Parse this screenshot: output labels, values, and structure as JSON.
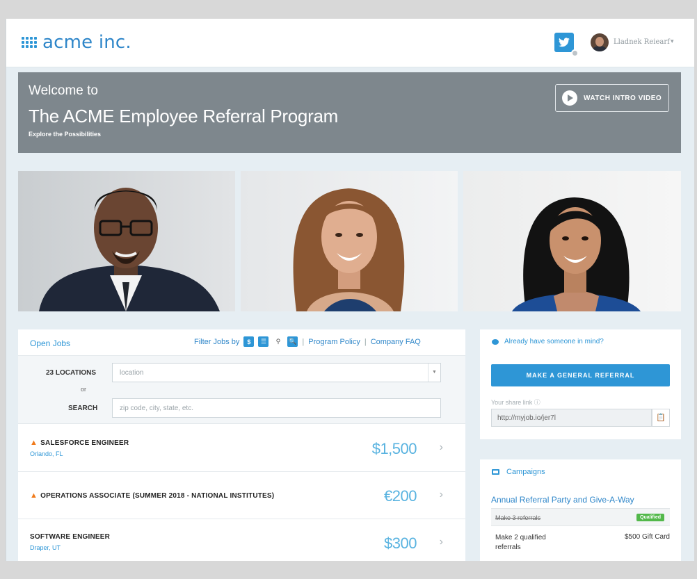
{
  "header": {
    "logo_text": "acme inc.",
    "user_name": "Lladnek Reiearf",
    "user_caret": "▾"
  },
  "hero": {
    "line1": "Welcome to",
    "line2": "The ACME Employee Referral Program",
    "line3": "Explore the Possibilities",
    "video_button": "WATCH INTRO VIDEO"
  },
  "jobs": {
    "title": "Open Jobs",
    "filter_label": "Filter Jobs by",
    "filter_buttons": [
      "$",
      "☰",
      "⚲",
      "🔍"
    ],
    "program_policy": "Program Policy",
    "company_faq": "Company FAQ",
    "separator": "|",
    "locations_label": "23 LOCATIONS",
    "or_label": "or",
    "search_label": "SEARCH",
    "location_placeholder": "location",
    "search_placeholder": "zip code, city, state, etc.",
    "list": [
      {
        "title": "SALESFORCE ENGINEER",
        "location": "Orlando, FL",
        "amount": "$1,500",
        "hot": true
      },
      {
        "title": "OPERATIONS ASSOCIATE (SUMMER 2018 - NATIONAL INSTITUTES)",
        "location": "",
        "amount": "€200",
        "hot": true
      },
      {
        "title": "SOFTWARE ENGINEER",
        "location": "Draper, UT",
        "amount": "$300",
        "hot": false
      }
    ]
  },
  "referral": {
    "prompt": "Already have someone in mind?",
    "general_button": "MAKE A GENERAL REFERRAL",
    "share_label": "Your share link ⓘ",
    "share_link": "http://myjob.io/jer7l",
    "copy_icon": "📋"
  },
  "campaigns": {
    "header": "Campaigns",
    "campaign_title": "Annual Referral Party and Give-A-Way",
    "task1": "Make 3 referrals",
    "task1_status": "Qualified",
    "task2": "Make 2 qualified referrals",
    "task2_reward": "$500 Gift Card"
  },
  "colors": {
    "brand_blue": "#2e96d6",
    "hero_gray": "#7e878d",
    "qualified_green": "#52b84a",
    "hot_orange": "#f07a1b"
  },
  "icons": {
    "logo": "dots-grid-icon",
    "twitter": "twitter-icon",
    "play": "play-icon",
    "flame": "flame-icon",
    "chevron": "chevron-right-icon",
    "bubble": "chat-bubble-icon",
    "campaign": "ticket-icon",
    "copy": "clipboard-icon"
  }
}
